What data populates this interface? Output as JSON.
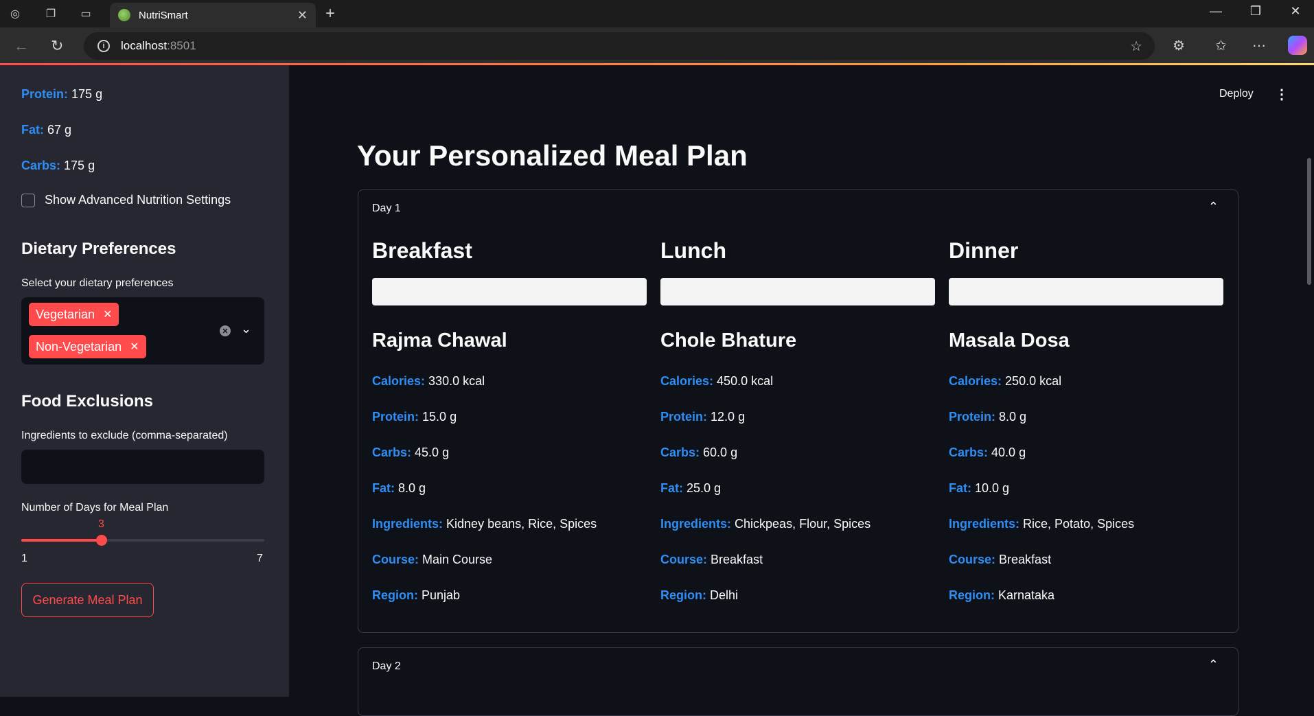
{
  "browser": {
    "tab_title": "NutriSmart",
    "url_host": "localhost",
    "url_port": ":8501"
  },
  "sidebar": {
    "targets": [
      {
        "label": "Protein:",
        "value": "175 g"
      },
      {
        "label": "Fat:",
        "value": "67 g"
      },
      {
        "label": "Carbs:",
        "value": "175 g"
      }
    ],
    "advanced_checkbox_label": "Show Advanced Nutrition Settings",
    "advanced_checked": false,
    "dietary_heading": "Dietary Preferences",
    "dietary_label": "Select your dietary preferences",
    "dietary_selected": [
      "Vegetarian",
      "Non-Vegetarian"
    ],
    "exclusions_heading": "Food Exclusions",
    "exclusions_label": "Ingredients to exclude (comma-separated)",
    "exclusions_value": "",
    "days_label": "Number of Days for Meal Plan",
    "days_value": "3",
    "days_min": "1",
    "days_max": "7",
    "generate_button": "Generate Meal Plan"
  },
  "header": {
    "deploy_label": "Deploy",
    "menu_icon": "kebab-menu-icon"
  },
  "main": {
    "title": "Your Personalized Meal Plan",
    "days": [
      {
        "label": "Day 1",
        "expanded": true,
        "meals": [
          {
            "course_heading": "Breakfast",
            "dish": "Rajma Chawal",
            "facts": [
              {
                "label": "Calories:",
                "value": "330.0 kcal"
              },
              {
                "label": "Protein:",
                "value": "15.0 g"
              },
              {
                "label": "Carbs:",
                "value": "45.0 g"
              },
              {
                "label": "Fat:",
                "value": "8.0 g"
              },
              {
                "label": "Ingredients:",
                "value": "Kidney beans, Rice, Spices"
              },
              {
                "label": "Course:",
                "value": "Main Course"
              },
              {
                "label": "Region:",
                "value": "Punjab"
              }
            ]
          },
          {
            "course_heading": "Lunch",
            "dish": "Chole Bhature",
            "facts": [
              {
                "label": "Calories:",
                "value": "450.0 kcal"
              },
              {
                "label": "Protein:",
                "value": "12.0 g"
              },
              {
                "label": "Carbs:",
                "value": "60.0 g"
              },
              {
                "label": "Fat:",
                "value": "25.0 g"
              },
              {
                "label": "Ingredients:",
                "value": "Chickpeas, Flour, Spices"
              },
              {
                "label": "Course:",
                "value": "Breakfast"
              },
              {
                "label": "Region:",
                "value": "Delhi"
              }
            ]
          },
          {
            "course_heading": "Dinner",
            "dish": "Masala Dosa",
            "facts": [
              {
                "label": "Calories:",
                "value": "250.0 kcal"
              },
              {
                "label": "Protein:",
                "value": "8.0 g"
              },
              {
                "label": "Carbs:",
                "value": "40.0 g"
              },
              {
                "label": "Fat:",
                "value": "10.0 g"
              },
              {
                "label": "Ingredients:",
                "value": "Rice, Potato, Spices"
              },
              {
                "label": "Course:",
                "value": "Breakfast"
              },
              {
                "label": "Region:",
                "value": "Karnataka"
              }
            ]
          }
        ]
      },
      {
        "label": "Day 2",
        "expanded": true
      }
    ]
  },
  "colors": {
    "accent": "#ff4b4b",
    "label_blue": "#2e8ef6",
    "sidebar_bg": "#262730",
    "main_bg": "#0e1117"
  }
}
